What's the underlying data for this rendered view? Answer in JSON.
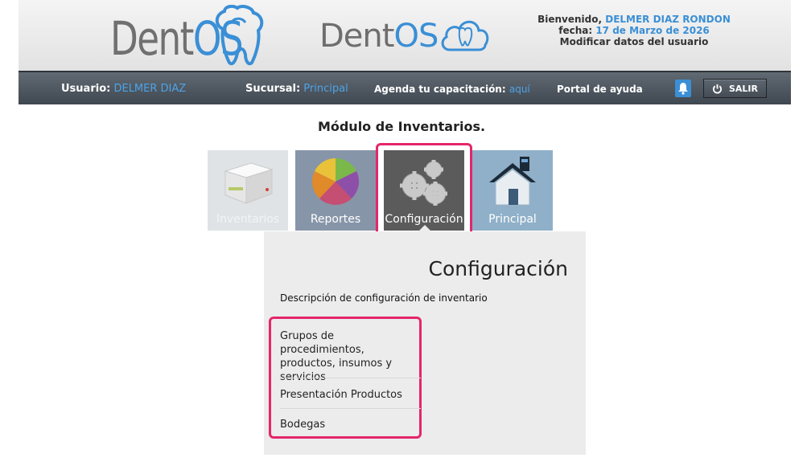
{
  "header": {
    "logo_text_prefix": "Dent",
    "logo_text_suffix": "OS",
    "logo2_text_prefix": "Dent",
    "logo2_text_suffix": "OS",
    "welcome_label": "Bienvenido,",
    "welcome_user": "DELMER DIAZ RONDON",
    "date_label": "fecha:",
    "date_value": "17 de Marzo de 2026",
    "modify_link": "Modificar datos del usuario"
  },
  "nav": {
    "user_label": "Usuario:",
    "user_value": "DELMER DIAZ",
    "branch_label": "Sucursal:",
    "branch_value": "Principal",
    "training_label": "Agenda tu capacitación:",
    "training_link": "aquí",
    "help_label": "Portal de ayuda",
    "logout_label": "SALIR"
  },
  "module_title": "Módulo de Inventarios.",
  "tiles": [
    {
      "label": "Inventarios"
    },
    {
      "label": "Reportes"
    },
    {
      "label": "Configuración"
    },
    {
      "label": "Principal"
    }
  ],
  "panel": {
    "title": "Configuración",
    "description": "Descripción de configuración de inventario",
    "items": [
      {
        "label": "Grupos de procedimientos, productos, insumos y servicios"
      },
      {
        "label": "Presentación Productos"
      },
      {
        "label": "Bodegas"
      }
    ]
  },
  "colors": {
    "accent_blue": "#3a8fd6",
    "highlight_pink": "#e5266b",
    "navbar": "#4a525b"
  }
}
